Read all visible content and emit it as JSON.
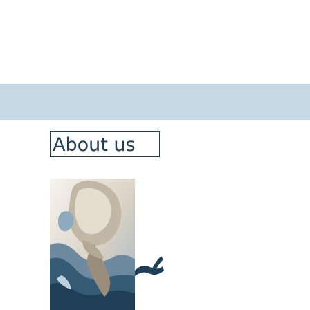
{
  "header": {
    "accent_color": "#c5d9e4"
  },
  "nav": {
    "about_label": "About us"
  },
  "hero": {
    "image_alt_name": "statue-image"
  }
}
